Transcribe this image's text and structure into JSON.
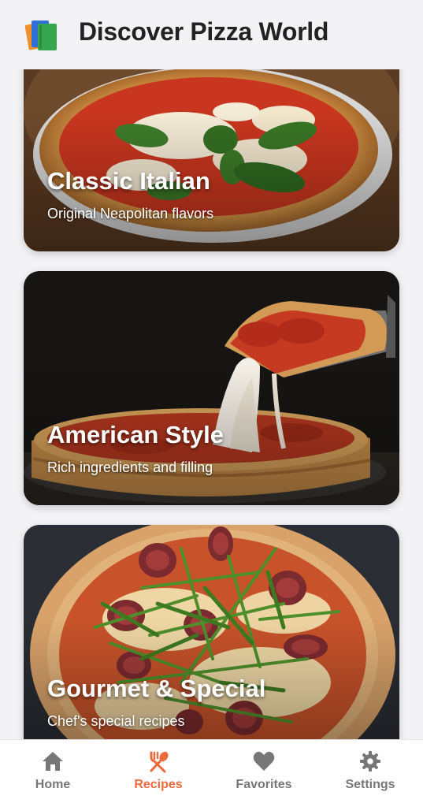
{
  "header": {
    "title": "Discover Pizza World",
    "logo_icon": "books-icon"
  },
  "cards": [
    {
      "title": "Classic Italian",
      "subtitle": "Original Neapolitan flavors"
    },
    {
      "title": "American Style",
      "subtitle": "Rich ingredients and filling"
    },
    {
      "title": "Gourmet & Special",
      "subtitle": "Chef's special recipes"
    }
  ],
  "nav": {
    "active": "Recipes",
    "items": [
      {
        "label": "Home",
        "icon": "home-icon"
      },
      {
        "label": "Recipes",
        "icon": "fork-spoon-icon"
      },
      {
        "label": "Favorites",
        "icon": "heart-icon"
      },
      {
        "label": "Settings",
        "icon": "gear-icon"
      }
    ]
  },
  "colors": {
    "accent": "#ef6a3b",
    "inactive": "#777777",
    "background": "#f3f3f5"
  }
}
